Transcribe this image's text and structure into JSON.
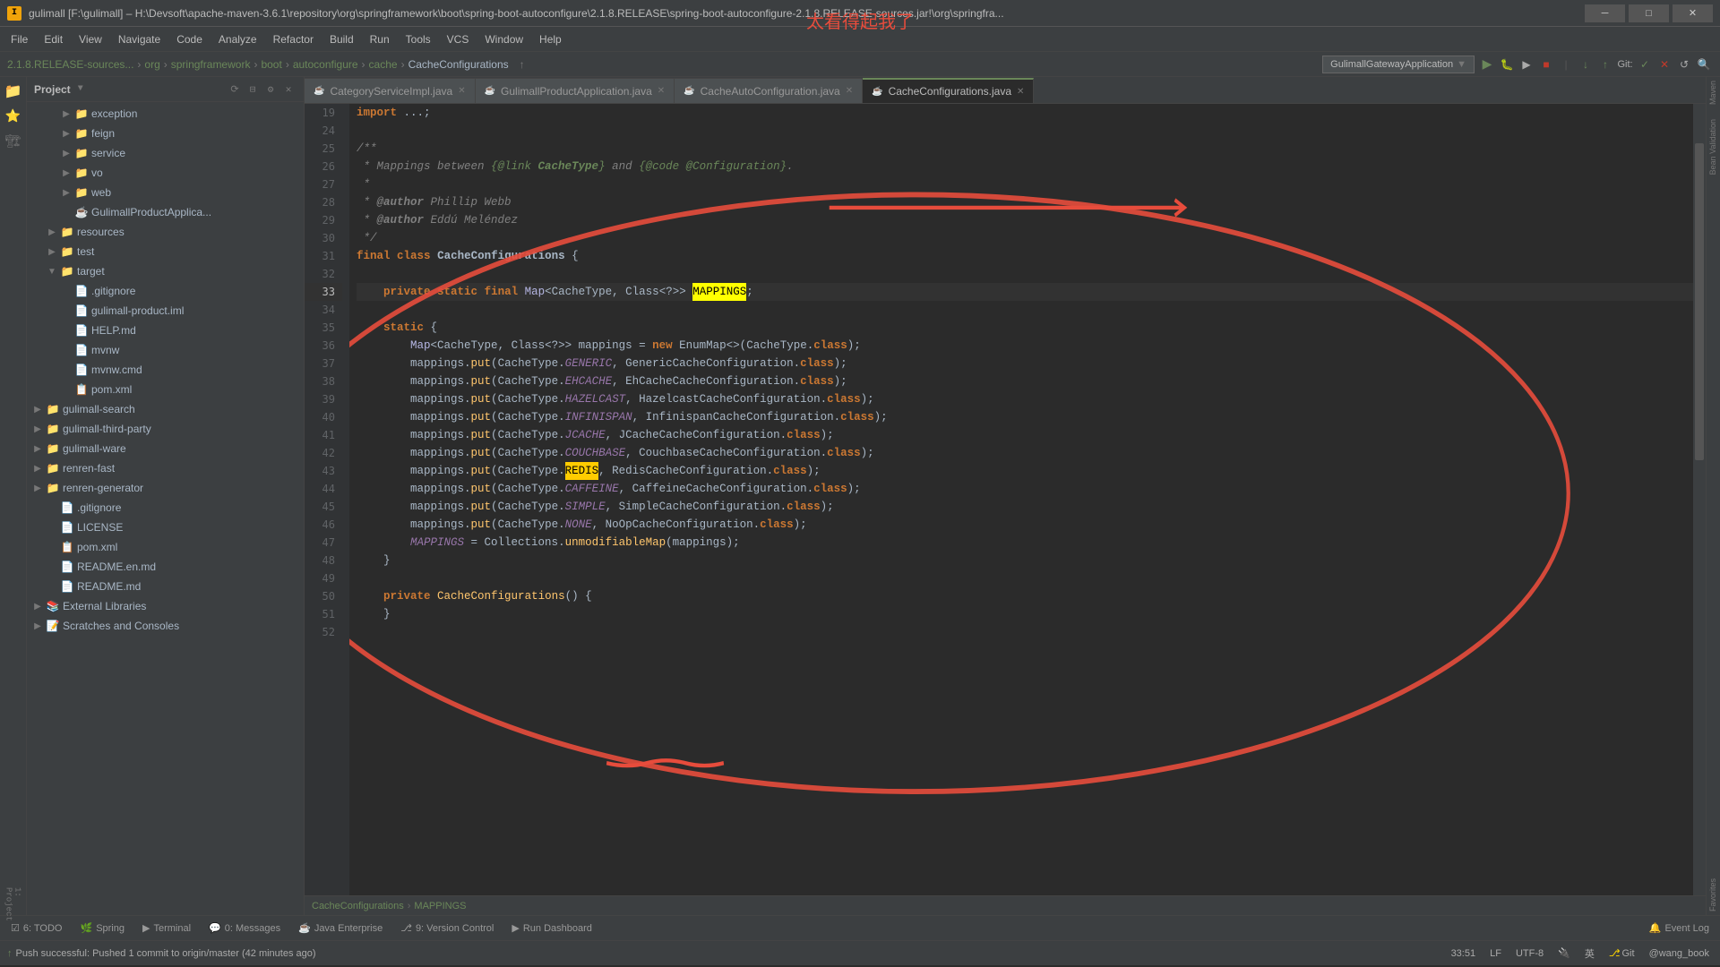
{
  "titleBar": {
    "text": "gulimall [F:\\gulimall] – H:\\Devsoft\\apache-maven-3.6.1\\repository\\org\\springframework\\boot\\spring-boot-autoconfigure\\2.1.8.RELEASE\\spring-boot-autoconfigure-2.1.8.RELEASE-sources.jar!\\org\\springfra...",
    "minimizeLabel": "─",
    "maximizeLabel": "□",
    "closeLabel": "✕"
  },
  "watermark": "太看得起我了",
  "menuBar": {
    "items": [
      "File",
      "Edit",
      "View",
      "Navigate",
      "Code",
      "Analyze",
      "Refactor",
      "Build",
      "Run",
      "Tools",
      "VCS",
      "Window",
      "Help"
    ]
  },
  "breadcrumbBar": {
    "items": [
      {
        "label": "2.1.8.RELEASE-sources..."
      },
      {
        "label": "org"
      },
      {
        "label": "springframework"
      },
      {
        "label": "boot"
      },
      {
        "label": "autoconfigure"
      },
      {
        "label": "cache"
      },
      {
        "label": "CacheConfigurations"
      }
    ],
    "runConfig": "GulimallGatewayApplication"
  },
  "tabs": [
    {
      "label": "CategoryServiceImpl.java",
      "active": false
    },
    {
      "label": "GulimallProductApplication.java",
      "active": false
    },
    {
      "label": "CacheAutoConfiguration.java",
      "active": false
    },
    {
      "label": "CacheConfigurations.java",
      "active": true
    }
  ],
  "projectPanel": {
    "title": "Project",
    "items": [
      {
        "level": 2,
        "type": "folder",
        "label": "exception",
        "arrow": "▶"
      },
      {
        "level": 2,
        "type": "folder",
        "label": "feign",
        "arrow": "▶"
      },
      {
        "level": 2,
        "type": "folder",
        "label": "service",
        "arrow": "▶"
      },
      {
        "level": 2,
        "type": "folder",
        "label": "vo",
        "arrow": "▶"
      },
      {
        "level": 2,
        "type": "folder",
        "label": "web",
        "arrow": "▶"
      },
      {
        "level": 2,
        "type": "file-java",
        "label": "GulimallProductApplica...",
        "arrow": ""
      },
      {
        "level": 1,
        "type": "folder",
        "label": "resources",
        "arrow": "▶"
      },
      {
        "level": 1,
        "type": "folder-test",
        "label": "test",
        "arrow": "▶"
      },
      {
        "level": 1,
        "type": "folder-target",
        "label": "target",
        "arrow": "▼"
      },
      {
        "level": 2,
        "type": "file",
        "label": ".gitignore",
        "arrow": ""
      },
      {
        "level": 2,
        "type": "file",
        "label": "gulimall-product.iml",
        "arrow": ""
      },
      {
        "level": 2,
        "type": "file",
        "label": "HELP.md",
        "arrow": ""
      },
      {
        "level": 2,
        "type": "folder",
        "label": "mvnw",
        "arrow": ""
      },
      {
        "level": 2,
        "type": "folder",
        "label": "mvnw.cmd",
        "arrow": ""
      },
      {
        "level": 2,
        "type": "file-xml",
        "label": "pom.xml",
        "arrow": ""
      },
      {
        "level": 0,
        "type": "module",
        "label": "gulimall-search",
        "arrow": "▶"
      },
      {
        "level": 0,
        "type": "module",
        "label": "gulimall-third-party",
        "arrow": "▶"
      },
      {
        "level": 0,
        "type": "module",
        "label": "gulimall-ware",
        "arrow": "▶"
      },
      {
        "level": 0,
        "type": "module",
        "label": "renren-fast",
        "arrow": "▶"
      },
      {
        "level": 0,
        "type": "module",
        "label": "renren-generator",
        "arrow": "▶"
      },
      {
        "level": 1,
        "type": "file",
        "label": ".gitignore",
        "arrow": ""
      },
      {
        "level": 1,
        "type": "file",
        "label": "LICENSE",
        "arrow": ""
      },
      {
        "level": 1,
        "type": "file-xml",
        "label": "pom.xml",
        "arrow": ""
      },
      {
        "level": 1,
        "type": "file-md",
        "label": "README.en.md",
        "arrow": ""
      },
      {
        "level": 1,
        "type": "file-md",
        "label": "README.md",
        "arrow": ""
      },
      {
        "level": 0,
        "type": "module",
        "label": "External Libraries",
        "arrow": "▶"
      },
      {
        "level": 0,
        "type": "module",
        "label": "Scratches and Consoles",
        "arrow": "▶"
      }
    ]
  },
  "codeLines": [
    {
      "num": 19,
      "content": "import ...;"
    },
    {
      "num": 24,
      "content": ""
    },
    {
      "num": 25,
      "content": "/**"
    },
    {
      "num": 26,
      "content": " * Mappings between {@link CacheType} and {@code @Configuration}."
    },
    {
      "num": 27,
      "content": " *"
    },
    {
      "num": 28,
      "content": " * @author Phillip Webb"
    },
    {
      "num": 29,
      "content": " * @author Eddú Meléndez"
    },
    {
      "num": 30,
      "content": " */"
    },
    {
      "num": 31,
      "content": "final class CacheConfigurations {"
    },
    {
      "num": 32,
      "content": ""
    },
    {
      "num": 33,
      "content": "    private static final Map<CacheType, Class<?>> MAPPINGS;"
    },
    {
      "num": 34,
      "content": ""
    },
    {
      "num": 35,
      "content": "    static {"
    },
    {
      "num": 36,
      "content": "        Map<CacheType, Class<?>> mappings = new EnumMap<>(CacheType.class);"
    },
    {
      "num": 37,
      "content": "        mappings.put(CacheType.GENERIC, GenericCacheConfiguration.class);"
    },
    {
      "num": 38,
      "content": "        mappings.put(CacheType.EHCACHE, EhCacheCacheConfiguration.class);"
    },
    {
      "num": 39,
      "content": "        mappings.put(CacheType.HAZELCAST, HazelcastCacheConfiguration.class);"
    },
    {
      "num": 40,
      "content": "        mappings.put(CacheType.INFINISPAN, InfinispanCacheConfiguration.class);"
    },
    {
      "num": 41,
      "content": "        mappings.put(CacheType.JCACHE, JCacheCacheConfiguration.class);"
    },
    {
      "num": 42,
      "content": "        mappings.put(CacheType.COUCHBASE, CouchbaseCacheConfiguration.class);"
    },
    {
      "num": 43,
      "content": "        mappings.put(CacheType.REDIS, RedisCacheConfiguration.class);"
    },
    {
      "num": 44,
      "content": "        mappings.put(CacheType.CAFFEINE, CaffeineCacheConfiguration.class);"
    },
    {
      "num": 45,
      "content": "        mappings.put(CacheType.SIMPLE, SimpleCacheConfiguration.class);"
    },
    {
      "num": 46,
      "content": "        mappings.put(CacheType.NONE, NoOpCacheConfiguration.class);"
    },
    {
      "num": 47,
      "content": "        MAPPINGS = Collections.unmodifiableMap(mappings);"
    },
    {
      "num": 48,
      "content": "    }"
    },
    {
      "num": 49,
      "content": ""
    },
    {
      "num": 50,
      "content": "    private CacheConfigurations() {"
    },
    {
      "num": 51,
      "content": "        }"
    },
    {
      "num": 52,
      "content": ""
    }
  ],
  "bottomBreadcrumb": {
    "items": [
      "CacheConfigurations",
      "MAPPINGS"
    ]
  },
  "bottomTabs": [
    {
      "label": "6: TODO",
      "badge": "",
      "active": false
    },
    {
      "label": "Spring",
      "badge": "",
      "active": false
    },
    {
      "label": "Terminal",
      "badge": "",
      "active": false
    },
    {
      "label": "0: Messages",
      "badge": "",
      "active": false
    },
    {
      "label": "Java Enterprise",
      "badge": "",
      "active": false
    },
    {
      "label": "9: Version Control",
      "badge": "",
      "active": false
    },
    {
      "label": "Run Dashboard",
      "badge": "",
      "active": false
    },
    {
      "label": "Event Log",
      "badge": "",
      "active": false
    }
  ],
  "statusBar": {
    "left": "Push successful: Pushed 1 commit to origin/master (42 minutes ago)",
    "position": "33:51",
    "encoding": "UTF-8",
    "lineSeparator": "LF",
    "lang": "英",
    "git": "Git",
    "user": "@wang_book"
  }
}
